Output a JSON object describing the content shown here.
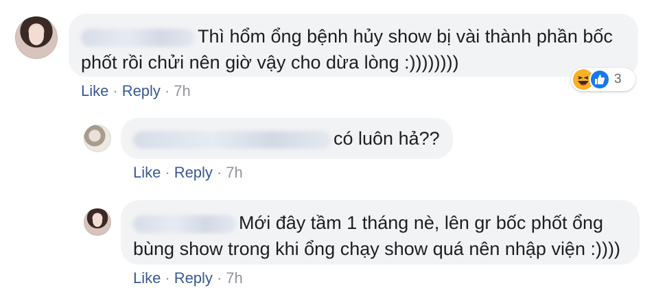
{
  "comments": [
    {
      "text_line1": "Thì hổm ổng bệnh hủy show bị vài thành phần bốc",
      "text_line2": "phốt rồi chửi nên giờ vậy cho dừa lòng :))))))))",
      "like": "Like",
      "reply": "Reply",
      "time": "7h",
      "reaction_count": "3",
      "reaction_icons": [
        "haha-icon",
        "like-icon"
      ]
    },
    {
      "text_line1": "có luôn hả??",
      "like": "Like",
      "reply": "Reply",
      "time": "7h"
    },
    {
      "text_line1": "Mới đây tầm 1 tháng nè, lên gr bốc phốt ổng",
      "text_line2": "bùng show trong khi ổng chạy show quá nên nhập viện :))))",
      "like": "Like",
      "reply": "Reply",
      "time": "7h"
    }
  ],
  "separator": "·",
  "colors": {
    "bubble": "#f2f3f5",
    "link": "#385898",
    "meta": "#90949c",
    "like_blue": "#1877f2",
    "haha_yellow": "#f7b125"
  }
}
